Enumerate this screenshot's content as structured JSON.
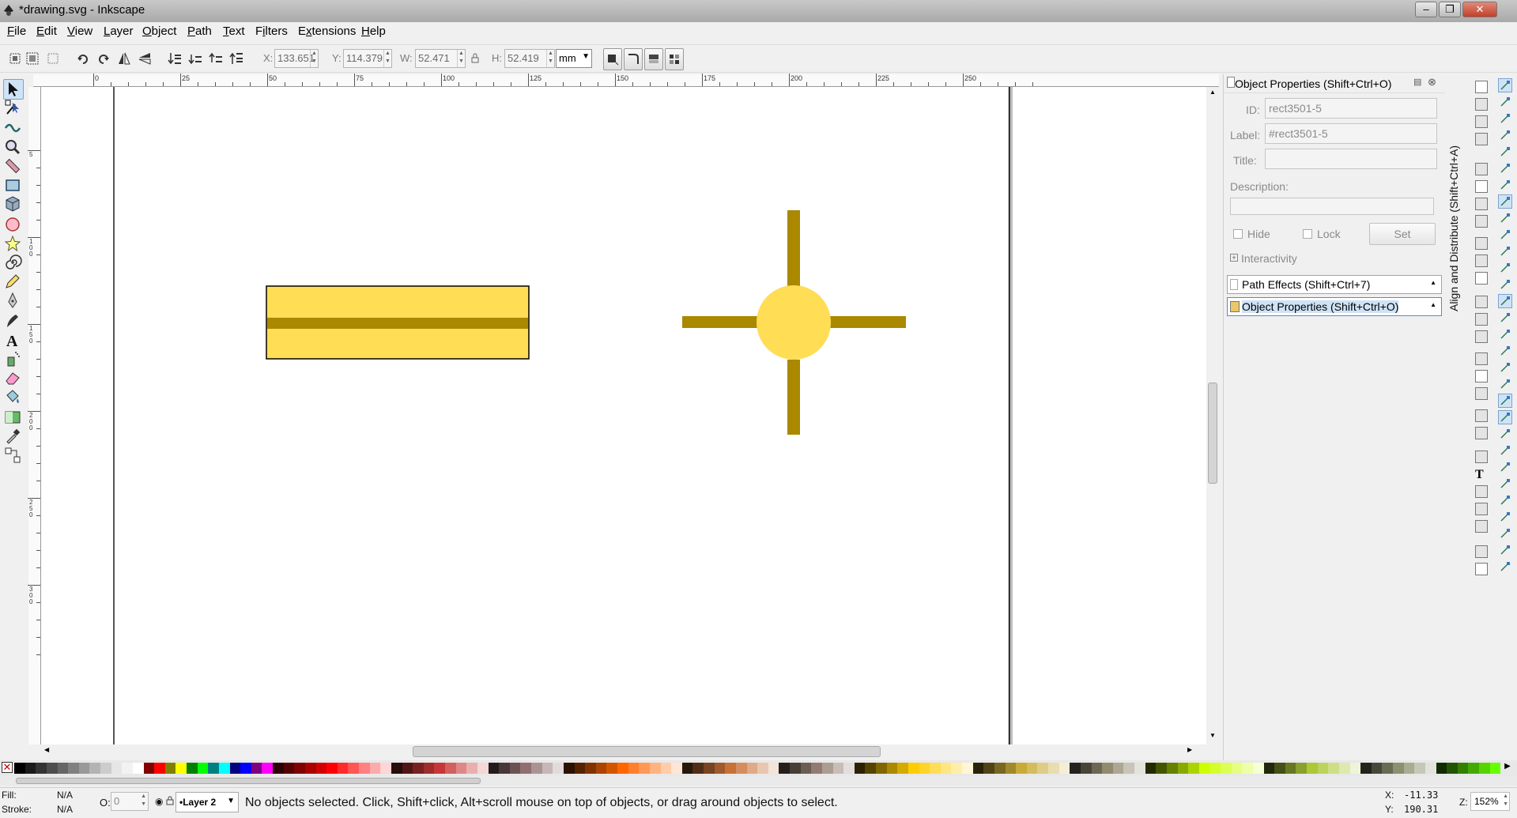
{
  "window": {
    "title": "*drawing.svg - Inkscape"
  },
  "menu": [
    "File",
    "Edit",
    "View",
    "Layer",
    "Object",
    "Path",
    "Text",
    "Filters",
    "Extensions",
    "Help"
  ],
  "menu_underline": [
    "F",
    "E",
    "V",
    "L",
    "O",
    "P",
    "T",
    "i",
    "x",
    "H"
  ],
  "toolbar": {
    "x_label": "X:",
    "x_value": "133.651",
    "y_label": "Y:",
    "y_value": "114.379",
    "w_label": "W:",
    "w_value": "52.471",
    "h_label": "H:",
    "h_value": "52.419",
    "units": "mm"
  },
  "ruler": {
    "h_labels": [
      "0",
      "25",
      "50",
      "75",
      "100",
      "125",
      "150",
      "175",
      "200",
      "225",
      "250"
    ],
    "v_labels": [
      "5",
      "1\n0\n0",
      "1\n5\n0",
      "2\n0\n0",
      "2\n5\n0",
      "3\n0\n0"
    ]
  },
  "tools": [
    "selector-tool",
    "node-tool",
    "tweak-tool",
    "zoom-tool",
    "measure-tool",
    "rect-tool",
    "3dbox-tool",
    "ellipse-tool",
    "star-tool",
    "spiral-tool",
    "pencil-tool",
    "pen-tool",
    "calligraphy-tool",
    "text-tool",
    "spray-tool",
    "eraser-tool",
    "paint-bucket-tool",
    "gradient-tool",
    "dropper-tool",
    "connector-tool"
  ],
  "panel": {
    "title": "Object Properties (Shift+Ctrl+O)",
    "id_label": "ID:",
    "id_value": "rect3501-5",
    "label_label": "Label:",
    "label_value": "#rect3501-5",
    "title_label": "Title:",
    "title_value": "",
    "description_label": "Description:",
    "hide_label": "Hide",
    "lock_label": "Lock",
    "set_button": "Set",
    "interactivity_label": "Interactivity",
    "dialogs": [
      "Path Effects  (Shift+Ctrl+7)",
      "Object Properties (Shift+Ctrl+O)"
    ],
    "side_tab": "Align and Distribute (Shift+Ctrl+A)"
  },
  "status": {
    "fill_label": "Fill:",
    "fill_value": "N/A",
    "stroke_label": "Stroke:",
    "stroke_value": "N/A",
    "opacity_label": "O:",
    "opacity_value": "0",
    "layer": "•Layer 2",
    "message": "No objects selected. Click, Shift+click, Alt+scroll mouse on top of objects, or drag around objects to select.",
    "cursor_x_label": "X:",
    "cursor_x": "-11.33",
    "cursor_y_label": "Y:",
    "cursor_y": "190.31",
    "zoom_label": "Z:",
    "zoom": "152%"
  },
  "colors": {
    "shape_fill": "#ffdd55",
    "shape_dark": "#aa8800",
    "shape_stroke": "#000000",
    "selected_tool_bg": "#cfe3f7"
  },
  "palette": [
    "#000000",
    "#1a1a1a",
    "#333333",
    "#4d4d4d",
    "#666666",
    "#808080",
    "#999999",
    "#b3b3b3",
    "#cccccc",
    "#e6e6e6",
    "#f2f2f2",
    "#ffffff",
    "#800000",
    "#ff0000",
    "#808000",
    "#ffff00",
    "#008000",
    "#00ff00",
    "#008080",
    "#00ffff",
    "#000080",
    "#0000ff",
    "#800080",
    "#ff00ff",
    "#2b0000",
    "#550000",
    "#800000",
    "#aa0000",
    "#d40000",
    "#ff0000",
    "#ff2a2a",
    "#ff5555",
    "#ff8080",
    "#ffaaaa",
    "#ffd5d5",
    "#280b0b",
    "#501616",
    "#782121",
    "#a02c2c",
    "#c83737",
    "#d35f5f",
    "#de8787",
    "#e9afaf",
    "#f4d7d7",
    "#241c1c",
    "#483737",
    "#6c5353",
    "#916f6f",
    "#ac9393",
    "#c8b7b7",
    "#e3dbdb",
    "#2b1100",
    "#552200",
    "#803300",
    "#aa4400",
    "#d45500",
    "#ff6600",
    "#ff7f2a",
    "#ff9955",
    "#ffb380",
    "#ffccaa",
    "#ffe6d5",
    "#28170b",
    "#502d16",
    "#784421",
    "#a05a2c",
    "#c87137",
    "#d38d5f",
    "#deaa87",
    "#e9c6af",
    "#f4e3d7",
    "#241f1c",
    "#483e37",
    "#6c5d53",
    "#917c6f",
    "#ac9d93",
    "#c8beb7",
    "#e3dedb",
    "#2b2200",
    "#554400",
    "#806600",
    "#aa8800",
    "#d4aa00",
    "#ffcc00",
    "#ffd42a",
    "#ffdd55",
    "#ffe680",
    "#ffeeaa",
    "#fff6d5",
    "#28220b",
    "#504416",
    "#786721",
    "#a0892c",
    "#c8ab37",
    "#d3bc5f",
    "#decd87",
    "#e9ddaf",
    "#f4eed7",
    "#24221c",
    "#484537",
    "#6c6753",
    "#918a6f",
    "#aca793",
    "#c8c4b7",
    "#e3e2db",
    "#222b00",
    "#445500",
    "#668000",
    "#88aa00",
    "#aad400",
    "#ccff00",
    "#d4ff2a",
    "#ddff55",
    "#e5ff80",
    "#eeffaa",
    "#f6ffd5",
    "#22280b",
    "#445016",
    "#677821",
    "#89a02c",
    "#abc837",
    "#bcd35f",
    "#cdde87",
    "#dde9af",
    "#eef4d7",
    "#22241c",
    "#454837",
    "#676c53",
    "#8a916f",
    "#a7ac93",
    "#c4c8b7",
    "#e2e3db",
    "#112b00",
    "#225500",
    "#338000",
    "#44aa00",
    "#55d400",
    "#66ff00"
  ]
}
